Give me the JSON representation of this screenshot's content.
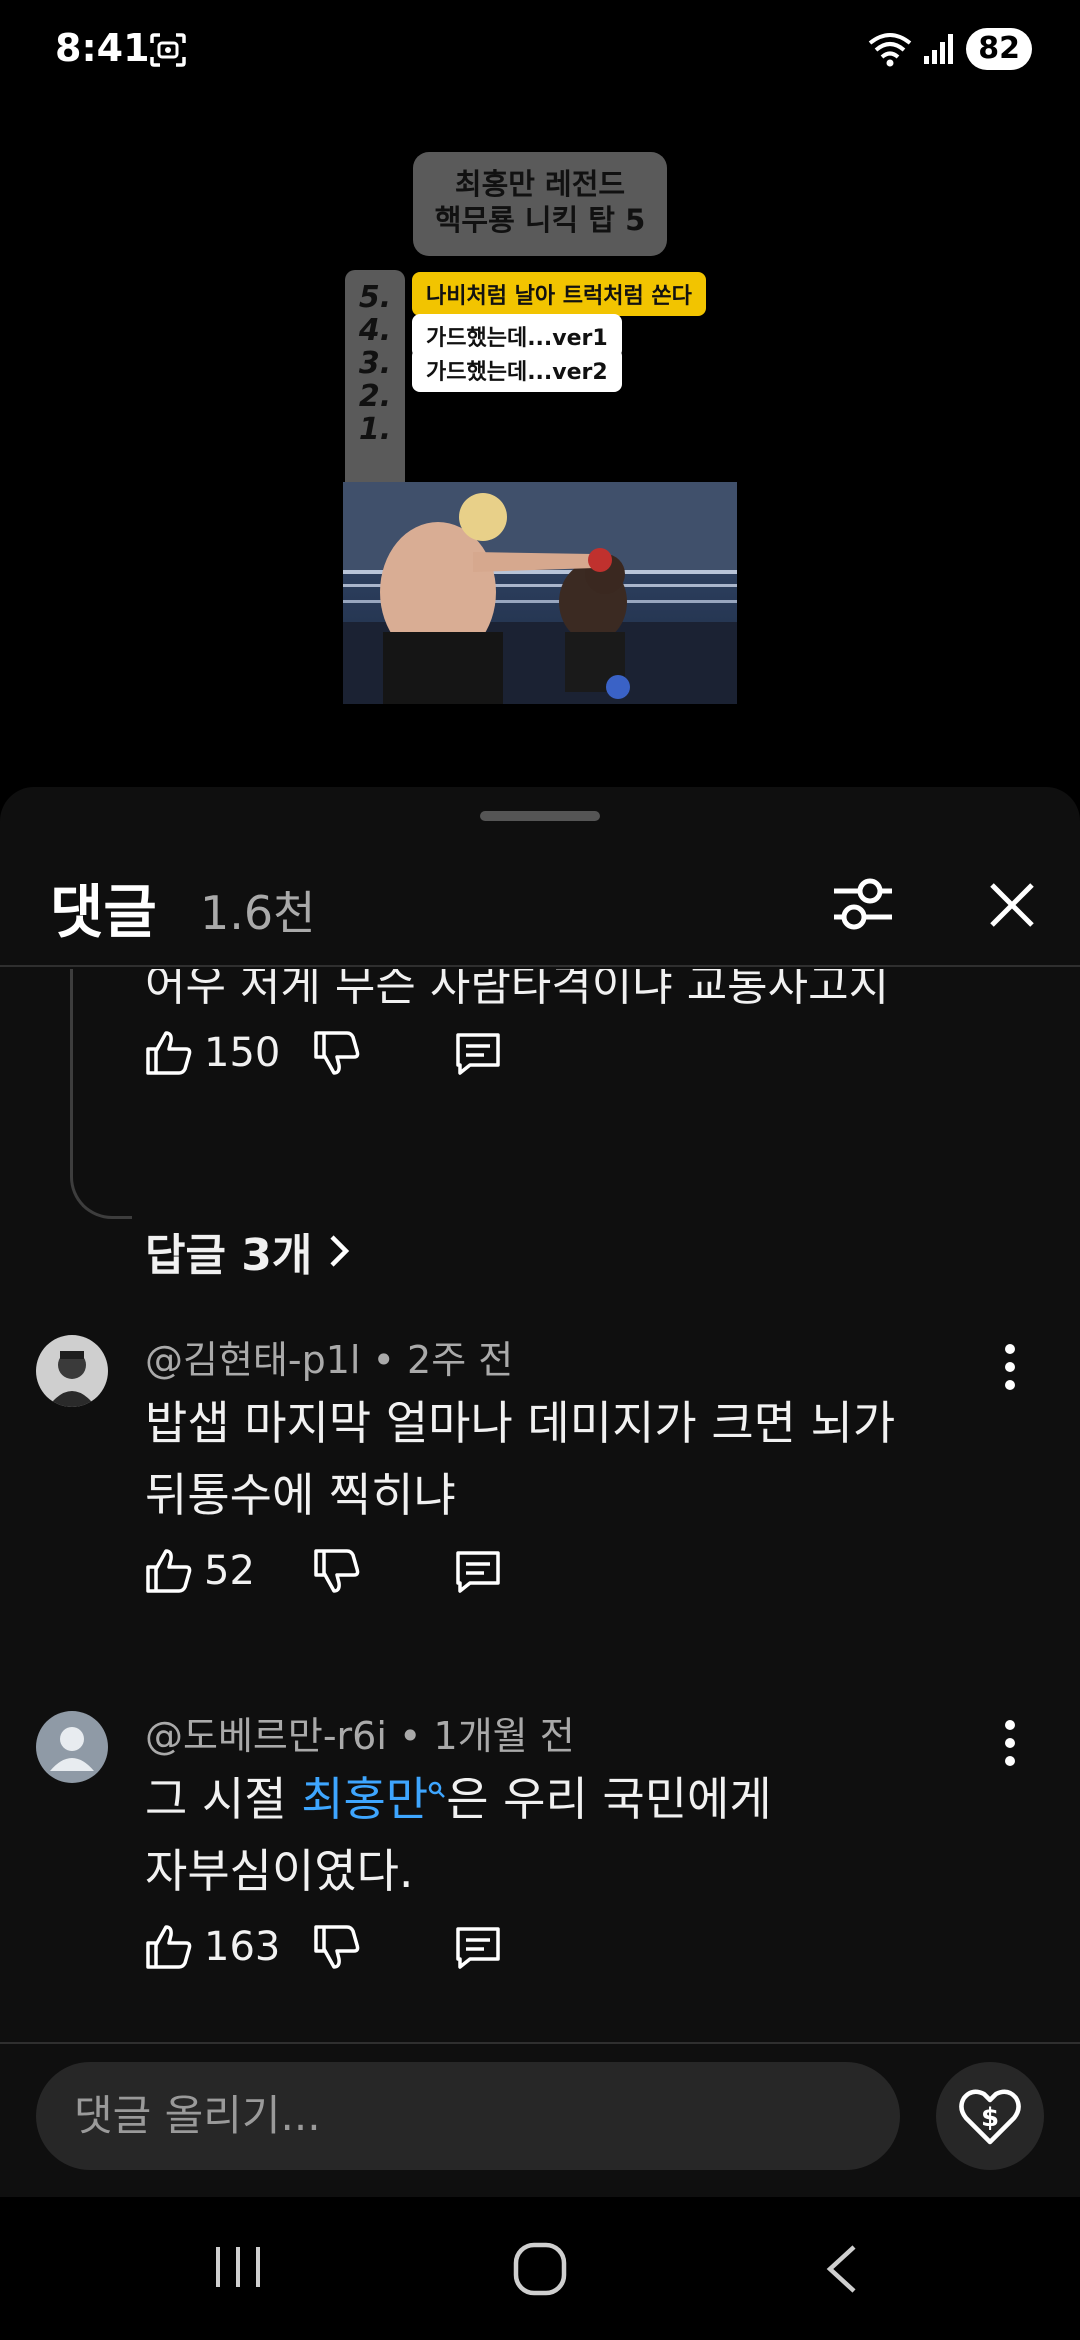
{
  "status_bar": {
    "time": "8:41",
    "battery": "82",
    "icons": [
      "screenshot-icon",
      "wifi-icon",
      "signal-icon"
    ]
  },
  "video": {
    "title_card": [
      "최홍만 레전드",
      "핵무룡 니킥 탑 5"
    ],
    "ranks": [
      "5.",
      "4.",
      "3.",
      "2.",
      "1."
    ],
    "tags": [
      "나비처럼 날아 트럭처럼 쏜다",
      "가드했는데...ver1",
      "가드했는데...ver2"
    ]
  },
  "sheet": {
    "title": "댓글",
    "count": "1.6천",
    "icons": [
      "filter-icon",
      "close-icon"
    ]
  },
  "thread": {
    "cut_text": "어우 저게 무슨 사람타격이냐 교통사고지",
    "likes": "150",
    "replies_link": "답글 3개"
  },
  "comments": [
    {
      "author": "@김현태-p1l",
      "time": "2주 전",
      "lines": [
        "밥샙 마지막 얼마나 데미지가 크면 뇌가",
        "뒤통수에 찍히냐"
      ],
      "likes": "52"
    },
    {
      "author": "@도베르만-r6i",
      "time": "1개월 전",
      "text_prefix": "그 시절 ",
      "hashtag": "최홍만",
      "text_suffix": "은 우리 국민에게",
      "line2": "자부심이였다.",
      "likes": "163"
    }
  ],
  "composer": {
    "placeholder": "댓글 올리기..."
  },
  "colors": {
    "sheet_bg": "#0f0f0f",
    "link_blue": "#3ea6ff",
    "input_bg": "#272727",
    "tag_yellow": "#f2c400"
  }
}
